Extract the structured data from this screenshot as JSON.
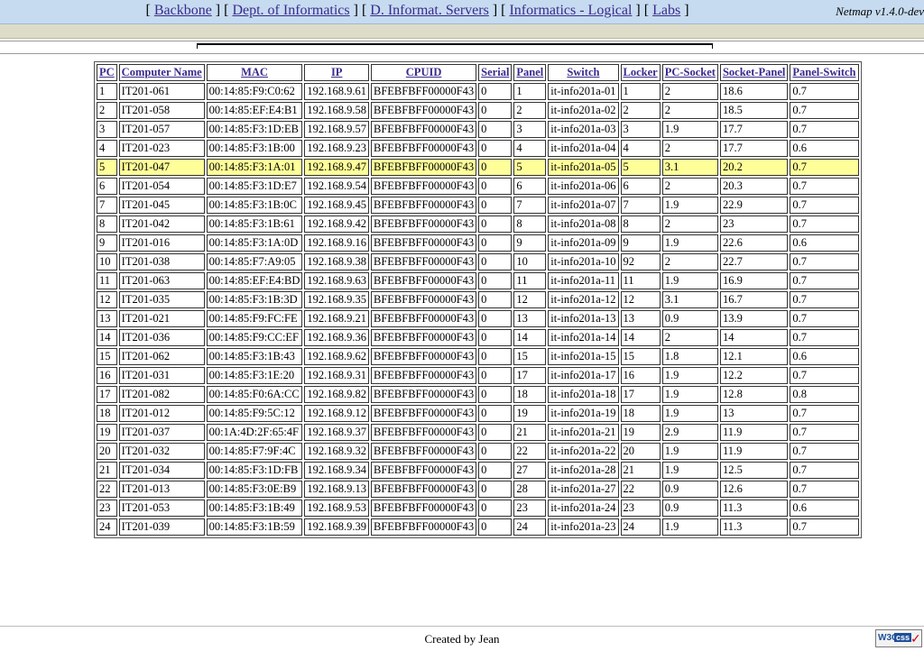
{
  "nav": {
    "links": [
      {
        "label": "Backbone"
      },
      {
        "label": "Dept. of Informatics"
      },
      {
        "label": "D. Informat. Servers"
      },
      {
        "label": "Informatics - Logical"
      },
      {
        "label": "Labs"
      }
    ],
    "version": "Netmap v1.4.0-dev"
  },
  "table": {
    "columns": [
      "PC",
      "Computer Name",
      "MAC",
      "IP",
      "CPUID",
      "Serial",
      "Panel",
      "Switch",
      "Locker",
      "PC-Socket",
      "Socket-Panel",
      "Panel-Switch"
    ],
    "highlighted_row": 4,
    "highlight_color": "#ffff99",
    "rows": [
      [
        "1",
        "IT201-061",
        "00:14:85:F9:C0:62",
        "192.168.9.61",
        "BFEBFBFF00000F43",
        "0",
        "1",
        "it-info201a-01",
        "1",
        "2",
        "18.6",
        "0.7"
      ],
      [
        "2",
        "IT201-058",
        "00:14:85:EF:E4:B1",
        "192.168.9.58",
        "BFEBFBFF00000F43",
        "0",
        "2",
        "it-info201a-02",
        "2",
        "2",
        "18.5",
        "0.7"
      ],
      [
        "3",
        "IT201-057",
        "00:14:85:F3:1D:EB",
        "192.168.9.57",
        "BFEBFBFF00000F43",
        "0",
        "3",
        "it-info201a-03",
        "3",
        "1.9",
        "17.7",
        "0.7"
      ],
      [
        "4",
        "IT201-023",
        "00:14:85:F3:1B:00",
        "192.168.9.23",
        "BFEBFBFF00000F43",
        "0",
        "4",
        "it-info201a-04",
        "4",
        "2",
        "17.7",
        "0.6"
      ],
      [
        "5",
        "IT201-047",
        "00:14:85:F3:1A:01",
        "192.168.9.47",
        "BFEBFBFF00000F43",
        "0",
        "5",
        "it-info201a-05",
        "5",
        "3.1",
        "20.2",
        "0.7"
      ],
      [
        "6",
        "IT201-054",
        "00:14:85:F3:1D:E7",
        "192.168.9.54",
        "BFEBFBFF00000F43",
        "0",
        "6",
        "it-info201a-06",
        "6",
        "2",
        "20.3",
        "0.7"
      ],
      [
        "7",
        "IT201-045",
        "00:14:85:F3:1B:0C",
        "192.168.9.45",
        "BFEBFBFF00000F43",
        "0",
        "7",
        "it-info201a-07",
        "7",
        "1.9",
        "22.9",
        "0.7"
      ],
      [
        "8",
        "IT201-042",
        "00:14:85:F3:1B:61",
        "192.168.9.42",
        "BFEBFBFF00000F43",
        "0",
        "8",
        "it-info201a-08",
        "8",
        "2",
        "23",
        "0.7"
      ],
      [
        "9",
        "IT201-016",
        "00:14:85:F3:1A:0D",
        "192.168.9.16",
        "BFEBFBFF00000F43",
        "0",
        "9",
        "it-info201a-09",
        "9",
        "1.9",
        "22.6",
        "0.6"
      ],
      [
        "10",
        "IT201-038",
        "00:14:85:F7:A9:05",
        "192.168.9.38",
        "BFEBFBFF00000F43",
        "0",
        "10",
        "it-info201a-10",
        "92",
        "2",
        "22.7",
        "0.7"
      ],
      [
        "11",
        "IT201-063",
        "00:14:85:EF:E4:BD",
        "192.168.9.63",
        "BFEBFBFF00000F43",
        "0",
        "11",
        "it-info201a-11",
        "11",
        "1.9",
        "16.9",
        "0.7"
      ],
      [
        "12",
        "IT201-035",
        "00:14:85:F3:1B:3D",
        "192.168.9.35",
        "BFEBFBFF00000F43",
        "0",
        "12",
        "it-info201a-12",
        "12",
        "3.1",
        "16.7",
        "0.7"
      ],
      [
        "13",
        "IT201-021",
        "00:14:85:F9:FC:FE",
        "192.168.9.21",
        "BFEBFBFF00000F43",
        "0",
        "13",
        "it-info201a-13",
        "13",
        "0.9",
        "13.9",
        "0.7"
      ],
      [
        "14",
        "IT201-036",
        "00:14:85:F9:CC:EF",
        "192.168.9.36",
        "BFEBFBFF00000F43",
        "0",
        "14",
        "it-info201a-14",
        "14",
        "2",
        "14",
        "0.7"
      ],
      [
        "15",
        "IT201-062",
        "00:14:85:F3:1B:43",
        "192.168.9.62",
        "BFEBFBFF00000F43",
        "0",
        "15",
        "it-info201a-15",
        "15",
        "1.8",
        "12.1",
        "0.6"
      ],
      [
        "16",
        "IT201-031",
        "00:14:85:F3:1E:20",
        "192.168.9.31",
        "BFEBFBFF00000F43",
        "0",
        "17",
        "it-info201a-17",
        "16",
        "1.9",
        "12.2",
        "0.7"
      ],
      [
        "17",
        "IT201-082",
        "00:14:85:F0:6A:CC",
        "192.168.9.82",
        "BFEBFBFF00000F43",
        "0",
        "18",
        "it-info201a-18",
        "17",
        "1.9",
        "12.8",
        "0.8"
      ],
      [
        "18",
        "IT201-012",
        "00:14:85:F9:5C:12",
        "192.168.9.12",
        "BFEBFBFF00000F43",
        "0",
        "19",
        "it-info201a-19",
        "18",
        "1.9",
        "13",
        "0.7"
      ],
      [
        "19",
        "IT201-037",
        "00:1A:4D:2F:65:4F",
        "192.168.9.37",
        "BFEBFBFF00000F43",
        "0",
        "21",
        "it-info201a-21",
        "19",
        "2.9",
        "11.9",
        "0.7"
      ],
      [
        "20",
        "IT201-032",
        "00:14:85:F7:9F:4C",
        "192.168.9.32",
        "BFEBFBFF00000F43",
        "0",
        "22",
        "it-info201a-22",
        "20",
        "1.9",
        "11.9",
        "0.7"
      ],
      [
        "21",
        "IT201-034",
        "00:14:85:F3:1D:FB",
        "192.168.9.34",
        "BFEBFBFF00000F43",
        "0",
        "27",
        "it-info201a-28",
        "21",
        "1.9",
        "12.5",
        "0.7"
      ],
      [
        "22",
        "IT201-013",
        "00:14:85:F3:0E:B9",
        "192.168.9.13",
        "BFEBFBFF00000F43",
        "0",
        "28",
        "it-info201a-27",
        "22",
        "0.9",
        "12.6",
        "0.7"
      ],
      [
        "23",
        "IT201-053",
        "00:14:85:F3:1B:49",
        "192.168.9.53",
        "BFEBFBFF00000F43",
        "0",
        "23",
        "it-info201a-24",
        "23",
        "0.9",
        "11.3",
        "0.6"
      ],
      [
        "24",
        "IT201-039",
        "00:14:85:F3:1B:59",
        "192.168.9.39",
        "BFEBFBFF00000F43",
        "0",
        "24",
        "it-info201a-23",
        "24",
        "1.9",
        "11.3",
        "0.7"
      ]
    ]
  },
  "footer": {
    "credit": "Created by Jean",
    "badge": {
      "w3c": "W3C",
      "css": "css",
      "check": "✓"
    }
  }
}
